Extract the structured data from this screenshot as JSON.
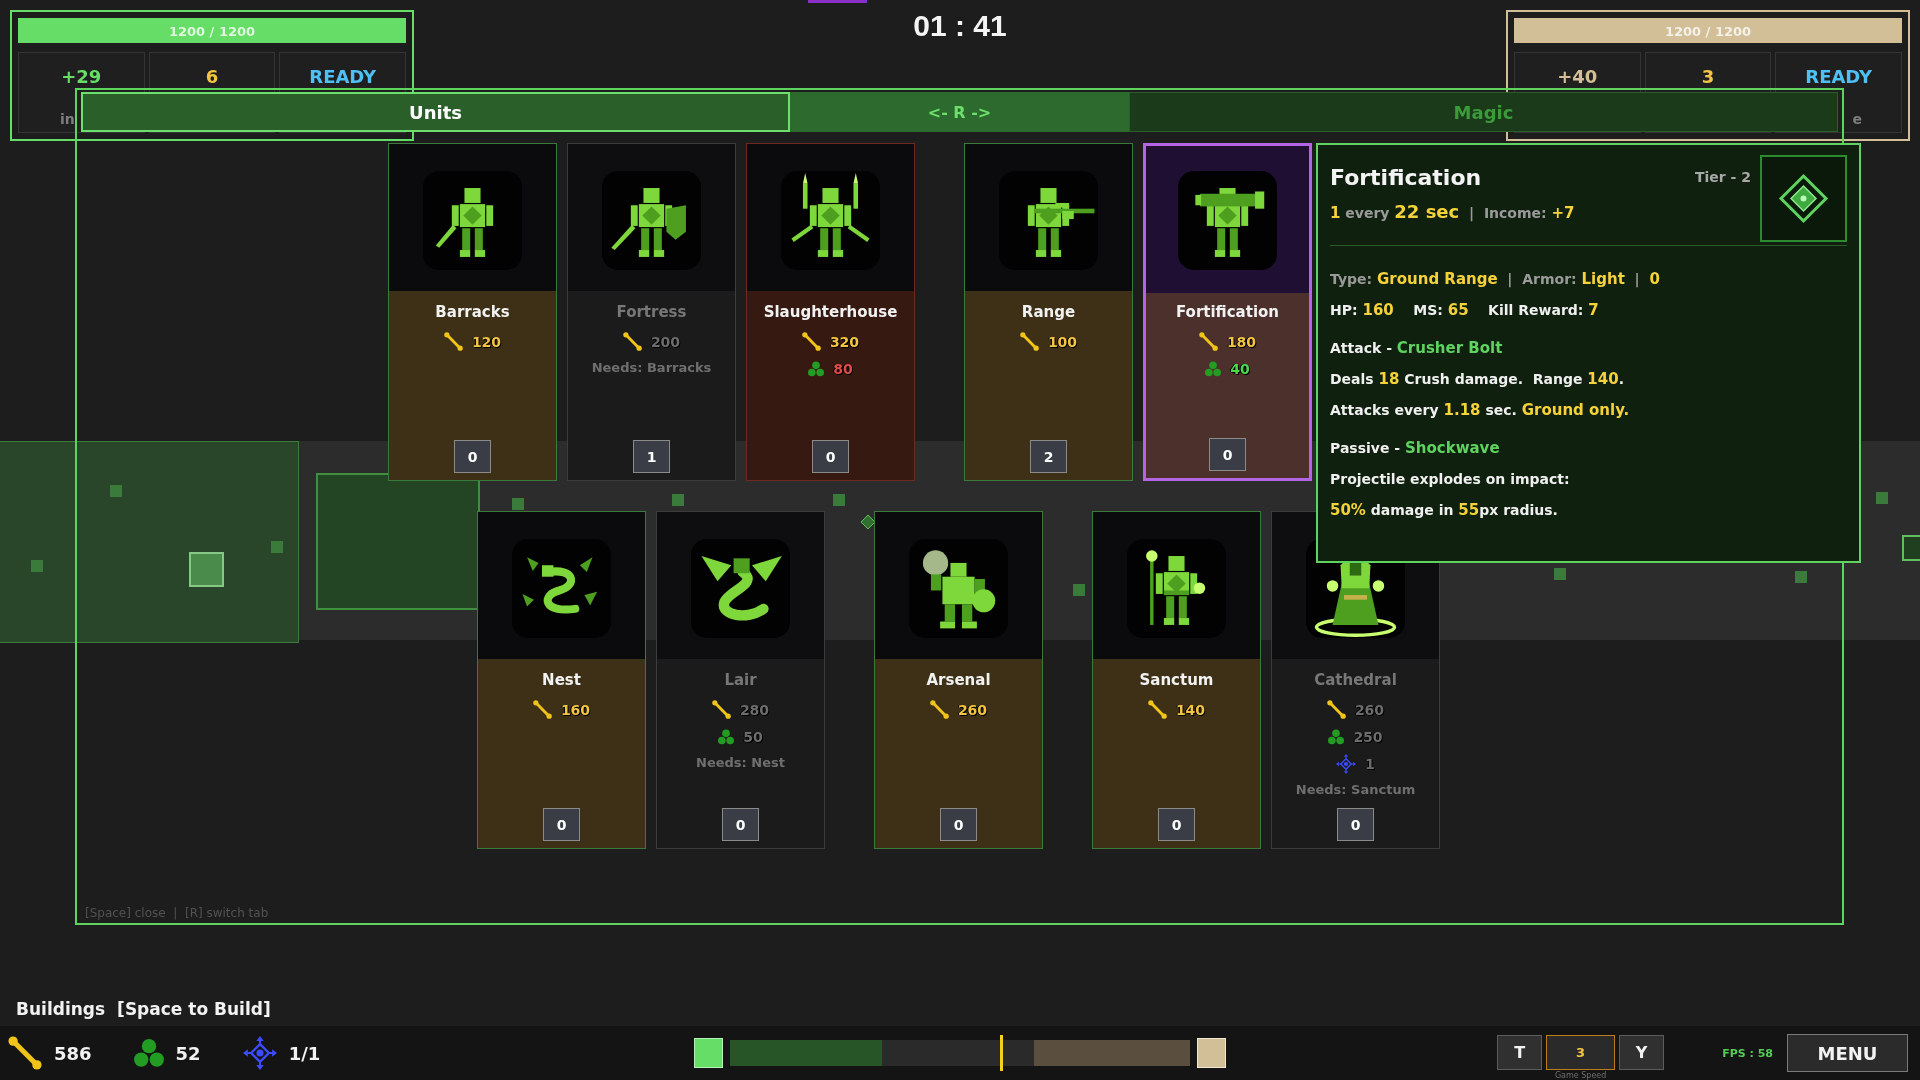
{
  "timer": "01 : 41",
  "players": [
    {
      "color": "#66dd66",
      "health": {
        "text": "1200 / 1200",
        "level": 1
      },
      "stats": [
        {
          "kind": "income",
          "value": "+29",
          "label": "in"
        },
        {
          "kind": "count",
          "value": "6"
        },
        {
          "kind": "status",
          "value": "READY"
        }
      ]
    },
    {
      "color": "#d2bf98",
      "health": {
        "text": "1200 / 1200",
        "level": 1
      },
      "stats": [
        {
          "kind": "income",
          "value": "+40"
        },
        {
          "kind": "count",
          "value": "3"
        },
        {
          "kind": "status",
          "value": "READY",
          "label": "e"
        }
      ]
    }
  ],
  "build_panel": {
    "tabs": [
      {
        "label": "Units",
        "selected": true
      },
      {
        "label": "Magic",
        "selected": false
      }
    ],
    "switch_hint": "<- R ->",
    "rows": [
      {
        "groups": [
          {
            "cards": [
              {
                "name": "Barracks",
                "locked": false,
                "selected": false,
                "costs": [
                  {
                    "kind": "gold",
                    "amount": "120",
                    "affordable": true
                  }
                ],
                "count": "0"
              },
              {
                "name": "Fortress",
                "locked": true,
                "selected": false,
                "costs": [
                  {
                    "kind": "gold",
                    "amount": "200"
                  }
                ],
                "requirement": "Needs: Barracks",
                "count": "1"
              },
              {
                "name": "Slaughterhouse",
                "locked": false,
                "selected": false,
                "costs": [
                  {
                    "kind": "gold",
                    "amount": "320",
                    "affordable": true
                  },
                  {
                    "kind": "supply",
                    "amount": "80",
                    "affordable": false
                  }
                ],
                "count": "0"
              }
            ]
          },
          {
            "cards": [
              {
                "name": "Range",
                "locked": false,
                "selected": false,
                "costs": [
                  {
                    "kind": "gold",
                    "amount": "100",
                    "affordable": true
                  }
                ],
                "count": "2"
              },
              {
                "name": "Fortification",
                "locked": false,
                "selected": true,
                "costs": [
                  {
                    "kind": "gold",
                    "amount": "180",
                    "affordable": true
                  },
                  {
                    "kind": "supply",
                    "amount": "40",
                    "affordable": true
                  }
                ],
                "count": "0"
              }
            ]
          }
        ]
      },
      {
        "groups": [
          {
            "cards": [
              {
                "name": "Nest",
                "locked": false,
                "selected": false,
                "costs": [
                  {
                    "kind": "gold",
                    "amount": "160",
                    "affordable": true
                  }
                ],
                "count": "0"
              },
              {
                "name": "Lair",
                "locked": true,
                "selected": false,
                "costs": [
                  {
                    "kind": "gold",
                    "amount": "280"
                  },
                  {
                    "kind": "supply",
                    "amount": "50"
                  }
                ],
                "requirement": "Needs: Nest",
                "count": "0"
              }
            ]
          },
          {
            "cards": [
              {
                "name": "Arsenal",
                "locked": false,
                "selected": false,
                "costs": [
                  {
                    "kind": "gold",
                    "amount": "260",
                    "affordable": true
                  }
                ],
                "count": "0"
              }
            ]
          },
          {
            "cards": [
              {
                "name": "Sanctum",
                "locked": false,
                "selected": false,
                "costs": [
                  {
                    "kind": "gold",
                    "amount": "140",
                    "affordable": true
                  }
                ],
                "count": "0"
              },
              {
                "name": "Cathedral",
                "locked": true,
                "selected": false,
                "costs": [
                  {
                    "kind": "gold",
                    "amount": "260"
                  },
                  {
                    "kind": "supply",
                    "amount": "250"
                  },
                  {
                    "kind": "slot",
                    "amount": "1"
                  }
                ],
                "requirement": "Needs: Sanctum",
                "count": "0"
              }
            ]
          }
        ]
      }
    ],
    "key_hint": "[Space] close  |  [R] switch tab"
  },
  "tooltip": {
    "title": "Fortification",
    "tier": "Tier - 2",
    "rate": [
      {
        "text": "1",
        "kind": "value"
      },
      {
        "text": " every ",
        "kind": "muted"
      },
      {
        "text": "22 sec",
        "kind": "value_large"
      },
      {
        "text": "  |  ",
        "kind": "muted"
      },
      {
        "text": "Income: ",
        "kind": "muted"
      },
      {
        "text": "+7",
        "kind": "value"
      }
    ],
    "sections": [
      {
        "lines": [
          {
            "segments": [
              {
                "text": "Type: ",
                "kind": "muted"
              },
              {
                "text": "Ground Range",
                "kind": "value"
              },
              {
                "text": "  |  ",
                "kind": "muted"
              },
              {
                "text": "Armor: ",
                "kind": "muted"
              },
              {
                "text": "Light",
                "kind": "value"
              },
              {
                "text": "  |  ",
                "kind": "muted"
              },
              {
                "text": "0",
                "kind": "value"
              }
            ]
          },
          {
            "segments": [
              {
                "text": "HP: ",
                "kind": "text"
              },
              {
                "text": "160",
                "kind": "value"
              },
              {
                "text": "    MS: ",
                "kind": "text"
              },
              {
                "text": "65",
                "kind": "value"
              },
              {
                "text": "    Kill Reward: ",
                "kind": "text"
              },
              {
                "text": "7",
                "kind": "value"
              }
            ]
          }
        ]
      },
      {
        "lines": [
          {
            "segments": [
              {
                "text": "Attack - ",
                "kind": "text"
              },
              {
                "text": "Crusher Bolt",
                "kind": "name"
              }
            ]
          },
          {
            "segments": [
              {
                "text": "Deals ",
                "kind": "text"
              },
              {
                "text": "18",
                "kind": "value"
              },
              {
                "text": " Crush damage.  Range ",
                "kind": "text"
              },
              {
                "text": "140",
                "kind": "value"
              },
              {
                "text": ".",
                "kind": "text"
              }
            ]
          },
          {
            "segments": [
              {
                "text": "Attacks every ",
                "kind": "text"
              },
              {
                "text": "1.18",
                "kind": "value"
              },
              {
                "text": " sec. ",
                "kind": "text"
              },
              {
                "text": "Ground only.",
                "kind": "value"
              }
            ]
          }
        ]
      },
      {
        "lines": [
          {
            "segments": [
              {
                "text": "Passive - ",
                "kind": "text"
              },
              {
                "text": "Shockwave",
                "kind": "name"
              }
            ]
          },
          {
            "segments": [
              {
                "text": "Projectile explodes on impact:",
                "kind": "text"
              }
            ]
          },
          {
            "segments": [
              {
                "text": "50%",
                "kind": "value"
              },
              {
                "text": " damage in ",
                "kind": "text"
              },
              {
                "text": "55",
                "kind": "value"
              },
              {
                "text": "px radius.",
                "kind": "text"
              }
            ]
          }
        ]
      }
    ]
  },
  "buildings": {
    "title": "Buildings",
    "hint": "[Space to Build]"
  },
  "resources": [
    {
      "kind": "gold",
      "amount": "586"
    },
    {
      "kind": "supply",
      "amount": "52"
    },
    {
      "kind": "slot",
      "amount": "1/1"
    }
  ],
  "balance_bar": {
    "left": {
      "level": 0.33
    },
    "right": {
      "level": 0.34
    },
    "marker": {
      "level": 0.59
    }
  },
  "speed": {
    "decrease": "T",
    "value": "3",
    "increase": "Y",
    "caption": "Game Speed"
  },
  "fps": "FPS : 58",
  "menu": "MENU"
}
